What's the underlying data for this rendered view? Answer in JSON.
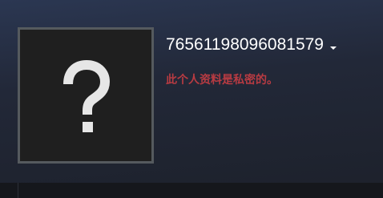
{
  "profile": {
    "persona_name": "76561198096081579",
    "privacy_message": "此个人资料是私密的。",
    "avatar": {
      "icon": "question-mark-icon",
      "glyph": "?"
    }
  },
  "colors": {
    "background_top": "#2b3752",
    "background_bottom": "#1d212b",
    "avatar_border": "#555a5e",
    "avatar_fill": "#1f1f1f",
    "private_text": "#b83b42",
    "name_text": "#ffffff"
  }
}
